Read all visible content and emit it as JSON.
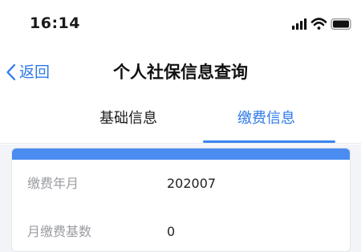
{
  "status_bar": {
    "time": "16:14",
    "signal_icon": "cellular-signal-icon",
    "wifi_icon": "wifi-icon"
  },
  "nav": {
    "back_label": "返回",
    "back_icon": "chevron-left-icon",
    "title": "个人社保信息查询"
  },
  "tabs": [
    {
      "label": "基础信息",
      "active": false
    },
    {
      "label": "缴费信息",
      "active": true
    }
  ],
  "record": {
    "fields": [
      {
        "label": "缴费年月",
        "value": "202007"
      },
      {
        "label": "月缴费基数",
        "value": "0"
      }
    ]
  },
  "colors": {
    "accent": "#2d7ae8",
    "card_header": "#4b8cf0",
    "label_gray": "#9a9ca2",
    "background": "#f3f4f7"
  }
}
